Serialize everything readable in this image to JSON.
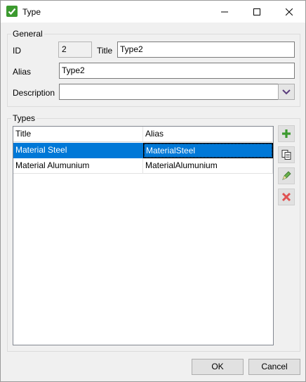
{
  "window": {
    "title": "Type"
  },
  "general": {
    "legend": "General",
    "id_label": "ID",
    "id_value": "2",
    "title_label": "Title",
    "title_value": "Type2",
    "alias_label": "Alias",
    "alias_value": "Type2",
    "description_label": "Description",
    "description_value": ""
  },
  "types": {
    "legend": "Types",
    "columns": [
      "Title",
      "Alias"
    ],
    "rows": [
      {
        "title": "Material Steel",
        "alias": "MaterialSteel",
        "selected": true
      },
      {
        "title": "Material Alumunium",
        "alias": "MaterialAlumunium",
        "selected": false
      }
    ]
  },
  "side_buttons": [
    "plus-icon",
    "copy-icon",
    "edit-icon",
    "delete-icon"
  ],
  "buttons": {
    "ok": "OK",
    "cancel": "Cancel"
  },
  "colors": {
    "selection": "#0078d7",
    "add": "#3c9a2f",
    "delete": "#e05252"
  }
}
